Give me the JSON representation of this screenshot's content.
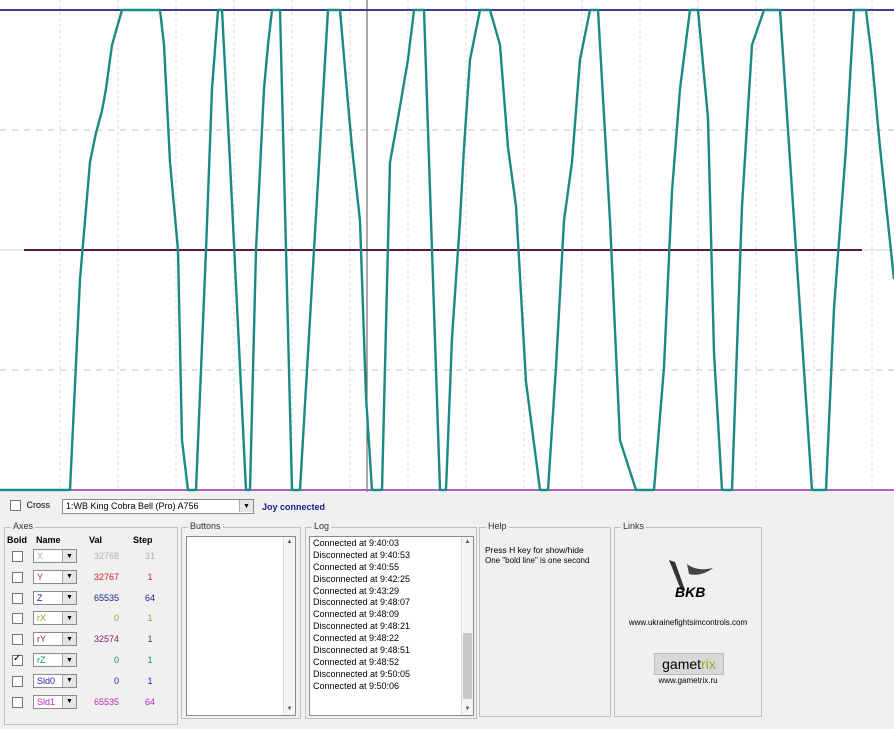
{
  "chart_data": {
    "type": "line",
    "x": [
      0,
      52,
      70,
      80,
      90,
      96,
      102,
      106,
      112,
      122,
      160,
      164,
      170,
      178,
      182,
      188,
      196,
      206,
      212,
      218,
      222,
      230,
      246,
      250,
      256,
      264,
      268,
      272,
      280,
      292,
      300,
      328,
      340,
      348,
      352,
      360,
      366,
      372,
      382,
      390,
      398,
      408,
      414,
      424,
      440,
      446,
      452,
      460,
      464,
      470,
      480,
      490,
      500,
      508,
      516,
      526,
      540,
      548,
      556,
      564,
      572,
      580,
      590,
      598,
      610,
      620,
      636,
      654,
      664,
      672,
      680,
      690,
      698,
      708,
      714,
      722,
      732,
      742,
      752,
      764,
      780,
      812,
      826,
      834,
      846,
      854,
      866,
      872,
      880,
      894
    ],
    "series": [
      {
        "values": [
          -32767,
          -32767,
          -32767,
          -4000,
          12000,
          16000,
          19000,
          22000,
          28000,
          32767,
          32767,
          28000,
          12000,
          0,
          -26000,
          -32767,
          -32767,
          0,
          22000,
          32767,
          32767,
          12000,
          -32767,
          -32767,
          0,
          22000,
          28000,
          32767,
          32767,
          -32767,
          -32767,
          32767,
          32767,
          20000,
          14000,
          4000,
          -20000,
          -32767,
          -32767,
          12000,
          18000,
          26000,
          32767,
          32767,
          -32767,
          -32767,
          -12000,
          4000,
          14000,
          26000,
          32767,
          32767,
          28000,
          14000,
          6000,
          -18000,
          -32767,
          -32767,
          -16000,
          4000,
          12000,
          26000,
          32767,
          32767,
          4000,
          -26000,
          -32767,
          -32767,
          -16000,
          8000,
          22000,
          32767,
          32767,
          18000,
          -14000,
          -32767,
          -32767,
          6000,
          28000,
          32767,
          32767,
          -32767,
          -32767,
          -8000,
          14000,
          32767,
          32767,
          26000,
          14000,
          -4000
        ],
        "color": "#1a8a82"
      }
    ],
    "ylim": [
      -32767,
      32767
    ],
    "flat_line_value": 0,
    "flat_line_color": "#5a1a4a",
    "top_line_color": "#3a3a9a",
    "bottom_line_color": "#b060c0",
    "grid_color": "#c0c0c0"
  },
  "cross": {
    "label": "Cross",
    "checked": false
  },
  "device": {
    "selected": "1:WB King Cobra Bell (Pro)  A756",
    "status": "Joy connected"
  },
  "axes": {
    "legend": "Axes",
    "headers": {
      "bold": "Bold",
      "name": "Name",
      "val": "Val",
      "step": "Step"
    },
    "rows": [
      {
        "name": "X",
        "value": "32768",
        "step": "31",
        "color": "#b0b0b0",
        "checked": false
      },
      {
        "name": "Y",
        "value": "32767",
        "step": "1",
        "color": "#d02020",
        "checked": false
      },
      {
        "name": "Z",
        "value": "65535",
        "step": "64",
        "color": "#1a1a8a",
        "checked": false
      },
      {
        "name": "rX",
        "value": "0",
        "step": "1",
        "color": "#a0a020",
        "checked": false
      },
      {
        "name": "rY",
        "value": "32574",
        "step": "1",
        "color": "#8a1a6a",
        "checked": false
      },
      {
        "name": "rZ",
        "value": "0",
        "step": "1",
        "color": "#1a8a82",
        "checked": true
      },
      {
        "name": "Sld0",
        "value": "0",
        "step": "1",
        "color": "#2020c0",
        "checked": false
      },
      {
        "name": "Sld1",
        "value": "65535",
        "step": "64",
        "color": "#c020c0",
        "checked": false
      }
    ]
  },
  "buttons_group": {
    "legend": "Buttons"
  },
  "log": {
    "legend": "Log",
    "lines": [
      "Connected at 9:40:03",
      "Disconnected at 9:40:53",
      "Connected at 9:40:55",
      "Disconnected at 9:42:25",
      "Connected at 9:43:29",
      "Disconnected at 9:48:07",
      "Connected at 9:48:09",
      "Disconnected at 9:48:21",
      "Connected at 9:48:22",
      "Disconnected at 9:48:51",
      "Connected at 9:48:52",
      "Disconnected at 9:50:05",
      "Connected at 9:50:06"
    ]
  },
  "help": {
    "legend": "Help",
    "line1": "Press H key for show/hide",
    "line2": "One \"bold line\" is one second"
  },
  "links": {
    "legend": "Links",
    "logo1_text": "BKB",
    "url1": "www.ukrainefightsimcontrols.com",
    "logo2_text1": "gamet",
    "logo2_text2": "rix",
    "url2": "www.gametrix.ru"
  }
}
